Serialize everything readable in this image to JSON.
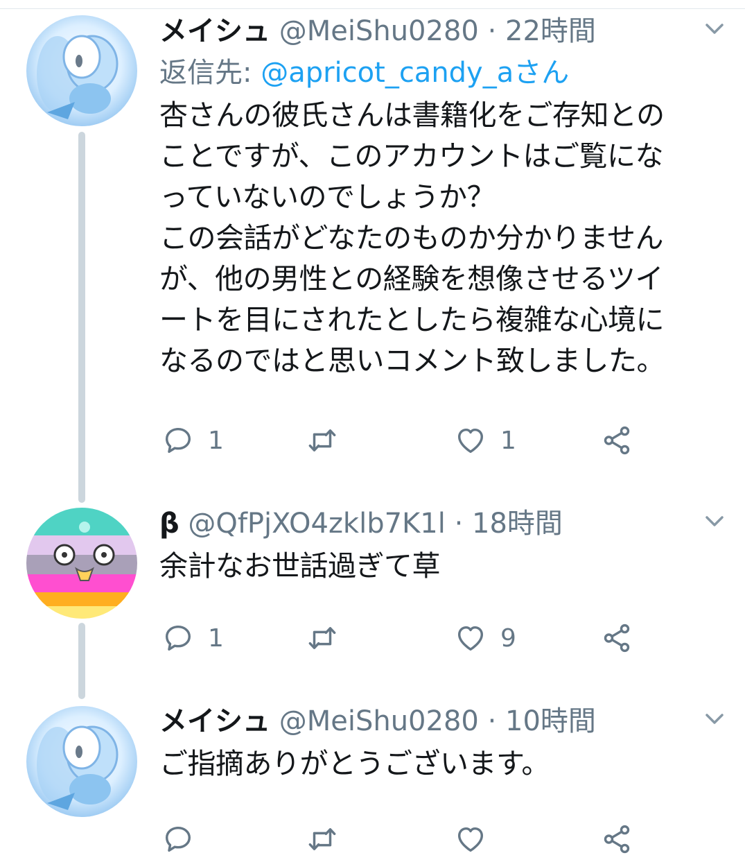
{
  "tweets": [
    {
      "name": "メイシュ",
      "handle": "@MeiShu0280",
      "sep": "·",
      "time": "22時間",
      "reply_prefix": "返信先: ",
      "reply_to": "@apricot_candy_aさん",
      "lines": [
        "杏さんの彼氏さんは書籍化をご存知との",
        "ことですが、このアカウントはご覧にな",
        "っていないのでしょうか？",
        "この会話がどなたのものか分かりません",
        "が、他の男性との経験を想像させるツイ",
        "ートを目にされたとしたら複雑な心境に",
        "なるのではと思いコメント致しました。"
      ],
      "reply_count": "1",
      "like_count": "1"
    },
    {
      "name": "β",
      "handle": "@QfPjXO4zklb7K1l",
      "sep": "·",
      "time": "18時間",
      "lines": [
        "余計なお世話過ぎて草"
      ],
      "reply_count": "1",
      "like_count": "9"
    },
    {
      "name": "メイシュ",
      "handle": "@MeiShu0280",
      "sep": "·",
      "time": "10時間",
      "lines": [
        "ご指摘ありがとうございます。"
      ]
    }
  ],
  "icons": [
    "chevron-down-icon",
    "reply-icon",
    "retweet-icon",
    "like-icon",
    "share-icon"
  ],
  "colors": {
    "text": "#14171a",
    "secondary": "#657786",
    "link": "#1da1f2",
    "thread_line": "#ccd6dd"
  }
}
